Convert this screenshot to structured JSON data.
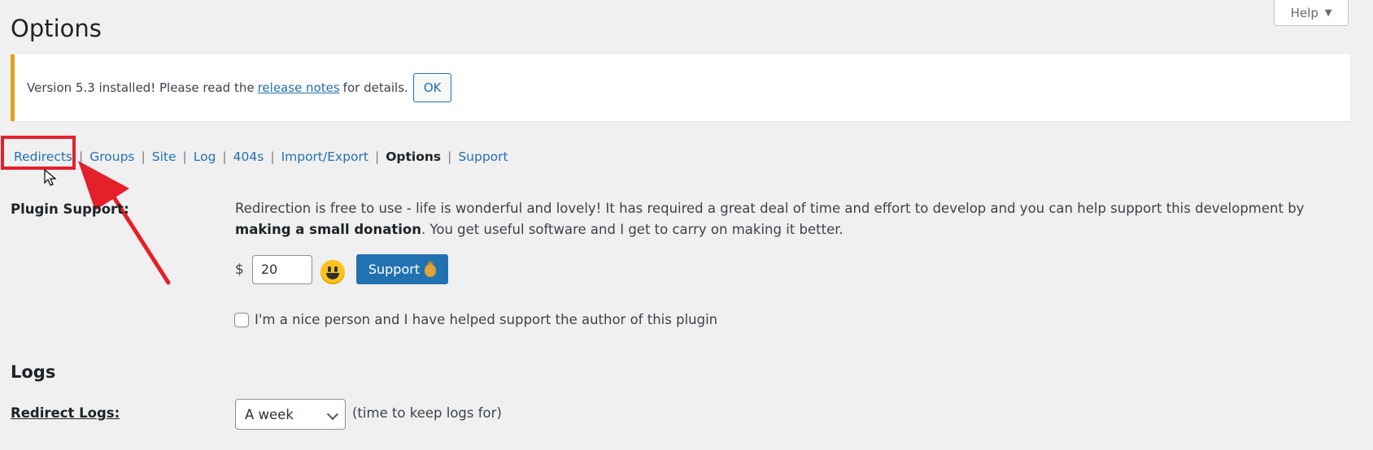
{
  "page": {
    "title": "Options"
  },
  "header": {
    "help_label": "Help"
  },
  "notice": {
    "text_before": "Version 5.3 installed! Please read the",
    "link_text": "release notes",
    "text_after": "for details.",
    "ok_label": "OK",
    "border_color": "#dba617"
  },
  "subnav": {
    "items": [
      {
        "label": "Redirects",
        "current": false
      },
      {
        "label": "Groups",
        "current": false
      },
      {
        "label": "Site",
        "current": false
      },
      {
        "label": "Log",
        "current": false
      },
      {
        "label": "404s",
        "current": false
      },
      {
        "label": "Import/Export",
        "current": false
      },
      {
        "label": "Options",
        "current": true
      },
      {
        "label": "Support",
        "current": false
      }
    ],
    "separator": "|"
  },
  "plugin_support": {
    "label": "Plugin Support:",
    "text_before": "Redirection is free to use - life is wonderful and lovely! It has required a great deal of time and effort to develop and you can help support this development by",
    "text_bold": "making a small donation",
    "text_after": ". You get useful software and I get to carry on making it better.",
    "currency": "$",
    "amount": "20",
    "smiley_icon": "grinning-face-icon",
    "support_button_label": "Support",
    "support_button_icon": "money-bag-icon",
    "checkbox_label": "I'm a nice person and I have helped support the author of this plugin",
    "checkbox_checked": false
  },
  "logs": {
    "section_title": "Logs",
    "redirect_logs_label": "Redirect Logs:",
    "redirect_logs_value": "A week",
    "redirect_logs_hint": "(time to keep logs for)"
  },
  "annotation": {
    "highlight_color": "#e5202b",
    "highlighted_item": "Redirects"
  },
  "colors": {
    "link": "#2271b1",
    "background": "#f0f0f1",
    "primary_button": "#2271b1"
  }
}
